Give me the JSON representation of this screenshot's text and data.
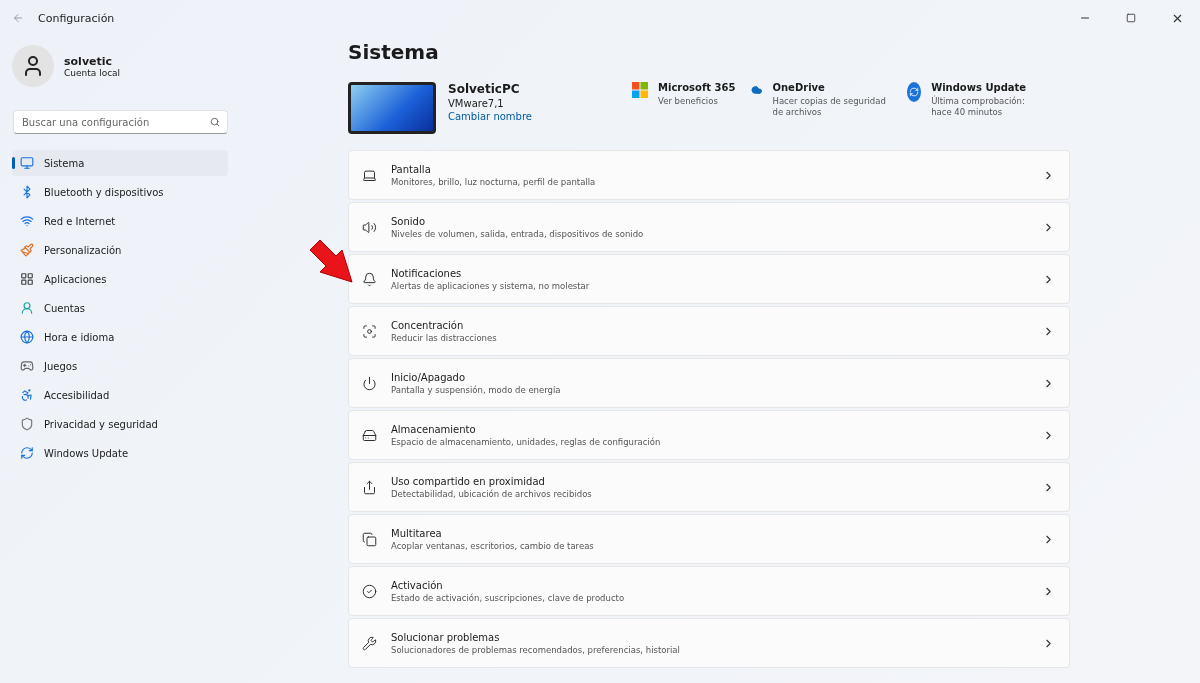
{
  "window": {
    "title": "Configuración"
  },
  "account": {
    "name": "solvetic",
    "type": "Cuenta local"
  },
  "search": {
    "placeholder": "Buscar una configuración"
  },
  "sidebar": {
    "items": [
      {
        "label": "Sistema",
        "selected": true
      },
      {
        "label": "Bluetooth y dispositivos",
        "selected": false
      },
      {
        "label": "Red e Internet",
        "selected": false
      },
      {
        "label": "Personalización",
        "selected": false
      },
      {
        "label": "Aplicaciones",
        "selected": false
      },
      {
        "label": "Cuentas",
        "selected": false
      },
      {
        "label": "Hora e idioma",
        "selected": false
      },
      {
        "label": "Juegos",
        "selected": false
      },
      {
        "label": "Accesibilidad",
        "selected": false
      },
      {
        "label": "Privacidad y seguridad",
        "selected": false
      },
      {
        "label": "Windows Update",
        "selected": false
      }
    ]
  },
  "page_title": "Sistema",
  "device": {
    "name": "SolveticPC",
    "model": "VMware7,1",
    "rename_link": "Cambiar nombre"
  },
  "services": [
    {
      "title": "Microsoft 365",
      "detail": "Ver beneficios"
    },
    {
      "title": "OneDrive",
      "detail": "Hacer copias de seguridad de archivos"
    },
    {
      "title": "Windows Update",
      "detail": "Última comprobación: hace 40 minutos"
    }
  ],
  "settings": [
    {
      "title": "Pantalla",
      "description": "Monitores, brillo, luz nocturna, perfil de pantalla"
    },
    {
      "title": "Sonido",
      "description": "Niveles de volumen, salida, entrada, dispositivos de sonido"
    },
    {
      "title": "Notificaciones",
      "description": "Alertas de aplicaciones y sistema, no molestar"
    },
    {
      "title": "Concentración",
      "description": "Reducir las distracciones"
    },
    {
      "title": "Inicio/Apagado",
      "description": "Pantalla y suspensión, modo de energía"
    },
    {
      "title": "Almacenamiento",
      "description": "Espacio de almacenamiento, unidades, reglas de configuración"
    },
    {
      "title": "Uso compartido en proximidad",
      "description": "Detectabilidad, ubicación de archivos recibidos"
    },
    {
      "title": "Multitarea",
      "description": "Acoplar ventanas, escritorios, cambio de tareas"
    },
    {
      "title": "Activación",
      "description": "Estado de activación, suscripciones, clave de producto"
    },
    {
      "title": "Solucionar problemas",
      "description": "Solucionadores de problemas recomendados, preferencias, historial"
    }
  ]
}
